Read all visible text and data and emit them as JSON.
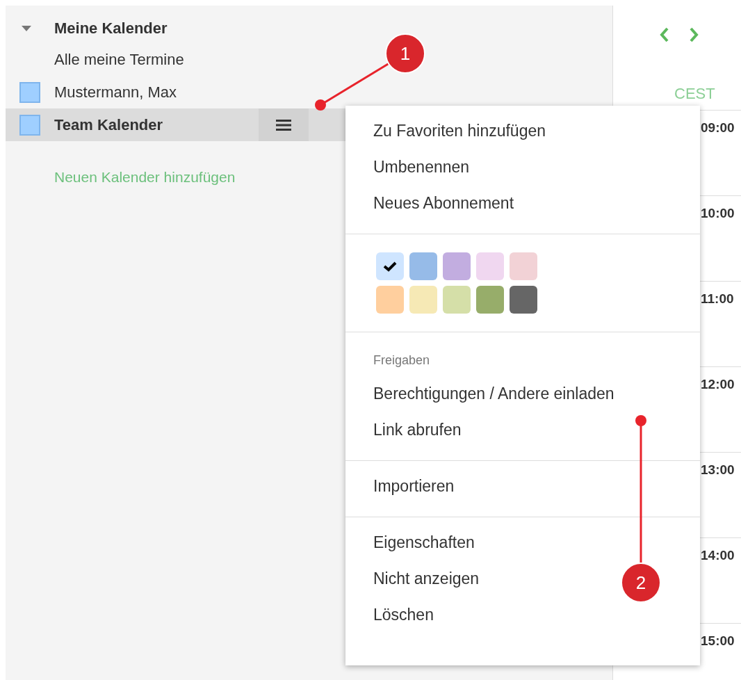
{
  "sidebar": {
    "section": {
      "title": "Meine Kalender",
      "expanded": true
    },
    "all_events": "Alle meine Termine",
    "calendars": [
      {
        "name": "Mustermann, Max",
        "color": "#9fcfff",
        "selected": false
      },
      {
        "name": "Team Kalender",
        "color": "#9fcfff",
        "selected": true
      }
    ],
    "add_link": "Neuen Kalender hinzufügen"
  },
  "calendar_view": {
    "timezone": "CEST",
    "times": [
      "09:00",
      "10:00",
      "11:00",
      "12:00",
      "13:00",
      "14:00",
      "15:00"
    ]
  },
  "context_menu": {
    "groups": [
      {
        "kind": "items",
        "items": [
          "Zu Favoriten hinzufügen",
          "Umbenennen",
          "Neues Abonnement"
        ]
      },
      {
        "kind": "colors",
        "swatches": [
          {
            "color": "#cfe5ff",
            "selected": true
          },
          {
            "color": "#96bbe8",
            "selected": false
          },
          {
            "color": "#c2ade0",
            "selected": false
          },
          {
            "color": "#f0d7f0",
            "selected": false
          },
          {
            "color": "#f2d2d6",
            "selected": false
          },
          {
            "color": "#ffcf9e",
            "selected": false
          },
          {
            "color": "#f6e9b5",
            "selected": false
          },
          {
            "color": "#d5dfa8",
            "selected": false
          },
          {
            "color": "#97ad6a",
            "selected": false
          },
          {
            "color": "#666666",
            "selected": false
          }
        ]
      },
      {
        "kind": "items",
        "heading": "Freigaben",
        "items": [
          "Berechtigungen / Andere einladen",
          "Link abrufen"
        ]
      },
      {
        "kind": "items",
        "items": [
          "Importieren"
        ]
      },
      {
        "kind": "items",
        "items": [
          "Eigenschaften",
          "Nicht anzeigen",
          "Löschen"
        ]
      }
    ]
  },
  "annotations": [
    {
      "label": "1"
    },
    {
      "label": "2"
    }
  ]
}
